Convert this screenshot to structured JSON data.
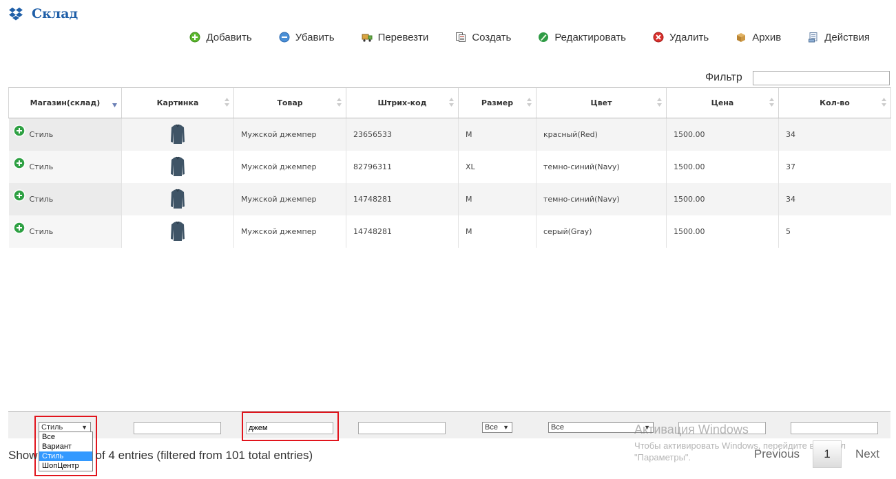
{
  "app": {
    "title": "Склад",
    "logo_icon": "dropbox-box-icon"
  },
  "toolbar": [
    {
      "label": "Добавить",
      "icon": "add-circle-icon"
    },
    {
      "label": "Убавить",
      "icon": "minus-circle-icon"
    },
    {
      "label": "Перевезти",
      "icon": "truck-icon"
    },
    {
      "label": "Создать",
      "icon": "document-copy-icon"
    },
    {
      "label": "Редактировать",
      "icon": "pencil-leaf-icon"
    },
    {
      "label": "Удалить",
      "icon": "delete-circle-icon"
    },
    {
      "label": "Архив",
      "icon": "archive-box-icon"
    },
    {
      "label": "Действия",
      "icon": "actions-list-icon"
    }
  ],
  "filter": {
    "label": "Фильтр",
    "value": ""
  },
  "table": {
    "columns": [
      "Магазин(склад)",
      "Картинка",
      "Товар",
      "Штрих-код",
      "Размер",
      "Цвет",
      "Цена",
      "Кол-во"
    ],
    "rows": [
      {
        "store": "Стиль",
        "product": "Мужской джемпер",
        "barcode": "23656533",
        "size": "M",
        "color": "красный(Red)",
        "price": "1500.00",
        "qty": "34"
      },
      {
        "store": "Стиль",
        "product": "Мужской джемпер",
        "barcode": "82796311",
        "size": "XL",
        "color": "темно-синий(Navy)",
        "price": "1500.00",
        "qty": "37"
      },
      {
        "store": "Стиль",
        "product": "Мужской джемпер",
        "barcode": "14748281",
        "size": "M",
        "color": "темно-синий(Navy)",
        "price": "1500.00",
        "qty": "34"
      },
      {
        "store": "Стиль",
        "product": "Мужской джемпер",
        "barcode": "14748281",
        "size": "M",
        "color": "серый(Gray)",
        "price": "1500.00",
        "qty": "5"
      }
    ]
  },
  "footer_filters": {
    "store_select": "Стиль",
    "store_options": [
      "Все",
      "Вариант",
      "Стиль",
      "ШопЦентр"
    ],
    "store_selected_index": 2,
    "picture": "",
    "product": "джем",
    "barcode": "",
    "size_select": "Все",
    "color_select": "Все",
    "price": "",
    "qty": ""
  },
  "info": {
    "prefix": "Show",
    "suffix": "of 4 entries (filtered from 101 total entries)"
  },
  "pagination": {
    "previous": "Previous",
    "current": "1",
    "next": "Next"
  },
  "watermark": {
    "line1": "Активация Windows",
    "line2": "Чтобы активировать Windows, перейдите в раздел",
    "line3": "\"Параметры\"."
  },
  "colors": {
    "title": "#1f5fa8",
    "highlight": "#e1141c",
    "selected_option": "#3399ff",
    "expand_button": "#2ea043"
  }
}
